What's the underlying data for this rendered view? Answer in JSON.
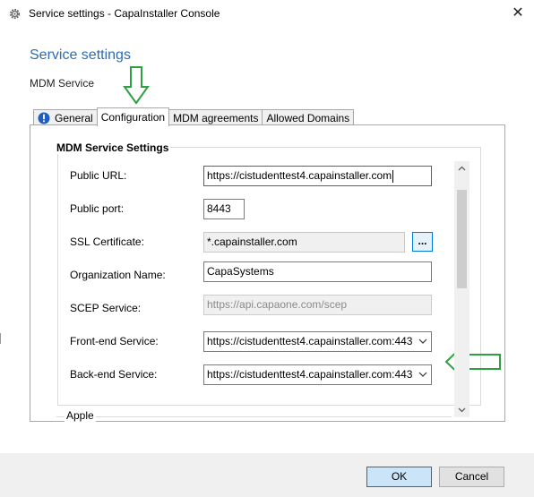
{
  "window": {
    "title": "Service settings - CapaInstaller Console",
    "app_icon": "gear-icon",
    "close_icon": "close-icon"
  },
  "header": {
    "title": "Service settings",
    "subtitle": "MDM Service"
  },
  "tabs": [
    {
      "label": "General",
      "icon": "info-icon",
      "active": false
    },
    {
      "label": "Configuration",
      "active": true
    },
    {
      "label": "MDM agreements",
      "active": false
    },
    {
      "label": "Allowed Domains",
      "active": false
    }
  ],
  "mdm_settings": {
    "group_title": "MDM Service Settings",
    "public_url": {
      "label": "Public URL:",
      "value": "https://cistudenttest4.capainstaller.com"
    },
    "public_port": {
      "label": "Public port:",
      "value": "8443"
    },
    "ssl_certificate": {
      "label": "SSL Certificate:",
      "value": "*.capainstaller.com",
      "browse_label": "..."
    },
    "organization_name": {
      "label": "Organization Name:",
      "value": "CapaSystems"
    },
    "scep_service": {
      "label": "SCEP Service:",
      "placeholder": "https://api.capaone.com/scep"
    },
    "front_end_service": {
      "label": "Front-end Service:",
      "value": "https://cistudenttest4.capainstaller.com:443"
    },
    "back_end_service": {
      "label": "Back-end Service:",
      "value": "https://cistudenttest4.capainstaller.com:443"
    }
  },
  "apple_group": {
    "title": "Apple"
  },
  "footer": {
    "ok_label": "OK",
    "cancel_label": "Cancel"
  },
  "annotations": {
    "color": "#2ea043",
    "icons": [
      "down-arrow-annotation-icon",
      "left-arrow-annotation-icon"
    ]
  }
}
